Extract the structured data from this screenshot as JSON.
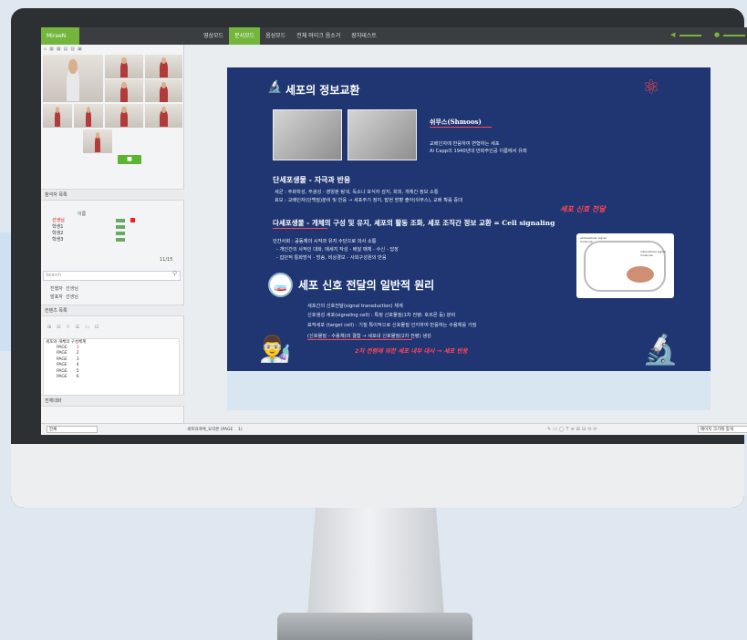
{
  "topbar": {
    "logo": "MiraeN",
    "tabs": [
      {
        "label": "영상모드",
        "active": false
      },
      {
        "label": "문서모드",
        "active": true
      },
      {
        "label": "음성모드",
        "active": false
      },
      {
        "label": "전체 마이크 음소거",
        "active": false
      },
      {
        "label": "장치테스트",
        "active": false
      }
    ],
    "accent": "#74b53d"
  },
  "left": {
    "participants_title": "참석자 목록",
    "column_name": "이름",
    "participants": [
      {
        "name": "선생님",
        "highlight": true
      },
      {
        "name": "학생1",
        "highlight": false
      },
      {
        "name": "학생2",
        "highlight": false
      },
      {
        "name": "학생3",
        "highlight": false
      }
    ],
    "count": "11/15",
    "search_placeholder": "Search",
    "presenter_label": "진행자",
    "presenter_value": "선생님",
    "speaker_label": "발표자",
    "speaker_value": "선생님",
    "contents_title": "컨텐츠 목록",
    "tree_root": "세포와 개체의 구성체계",
    "pages": [
      {
        "label": "PAGE",
        "num": "1"
      },
      {
        "label": "PAGE",
        "num": "2"
      },
      {
        "label": "PAGE",
        "num": "3"
      },
      {
        "label": "PAGE",
        "num": "4"
      },
      {
        "label": "PAGE",
        "num": "5"
      },
      {
        "label": "PAGE",
        "num": "6"
      }
    ],
    "chat_title": "전체대화",
    "chat_select": "전체"
  },
  "bottom": {
    "doc_name": "세포와개체_요약본 (PAGE",
    "doc_page": "1)",
    "fit_select": "페이지 크기에 맞게"
  },
  "slide": {
    "title1": "세포의 정보교환",
    "shmoos_title": "쉬무스(Shmoos)",
    "shmoos_desc1": "교배인자에 반응하여 변형하는 세포",
    "shmoos_desc2": "Al Capp의 1940년대 만화주인공 이름에서 유래",
    "unicell_title": "단세포생물 - 자극과 반응",
    "unicell_1": "세균 : 주화학성, 주광성 - 영양분 탐색, 독소나 포식자 감지, 회피, 개체간 정보 소통",
    "unicell_2": "효모 : 교배인자(단백질)분비 및 반응 → 세포주기 정지, 발현 방향 출아(쉬무스), 교배 확률 증대",
    "multi_title": "다세포생물 - 개체의 구성 및 유지, 세포의 활동 조화, 세포 조직간 정보 교환 = Cell signaling",
    "handwrite1": "세포 신호 전달",
    "society_1": "인간사회 : 공동체의 시작과 유지 수단으로 의사 소통",
    "society_2": "- 개인간의 사적인 대화, 메세지 작성 - 배달 매체 - 수신 - 답장",
    "society_3": "- 집단적 통화방식 - 방송, 비상경보 - 사회구성원의 반응",
    "title2": "세포 신호 전달의 일반적 원리",
    "sig_1": "세포간의 신호전달(signal transduction) 체계",
    "sig_2": "신호생성 세포(signaling cell) : 특정 신호물질(1차 전령: 호르몬 등) 분비",
    "sig_3": "표적세포 (target cell) : 기질 특이적으로 신호물질 인지하여 반응하는 수용체를 가짐",
    "sig_4": "(신호물질 - 수용체)의 결합 → 세포내 신호물질(2차 전령) 생성",
    "handwrite2": "2차 전령에 의한 세포 내부 대사 → 세포 반응",
    "diagram_label1": "extracellular signal molecule",
    "diagram_label2": "intracellular signal molecule",
    "bg": "#1f3672",
    "hand_color": "#ff4458"
  }
}
